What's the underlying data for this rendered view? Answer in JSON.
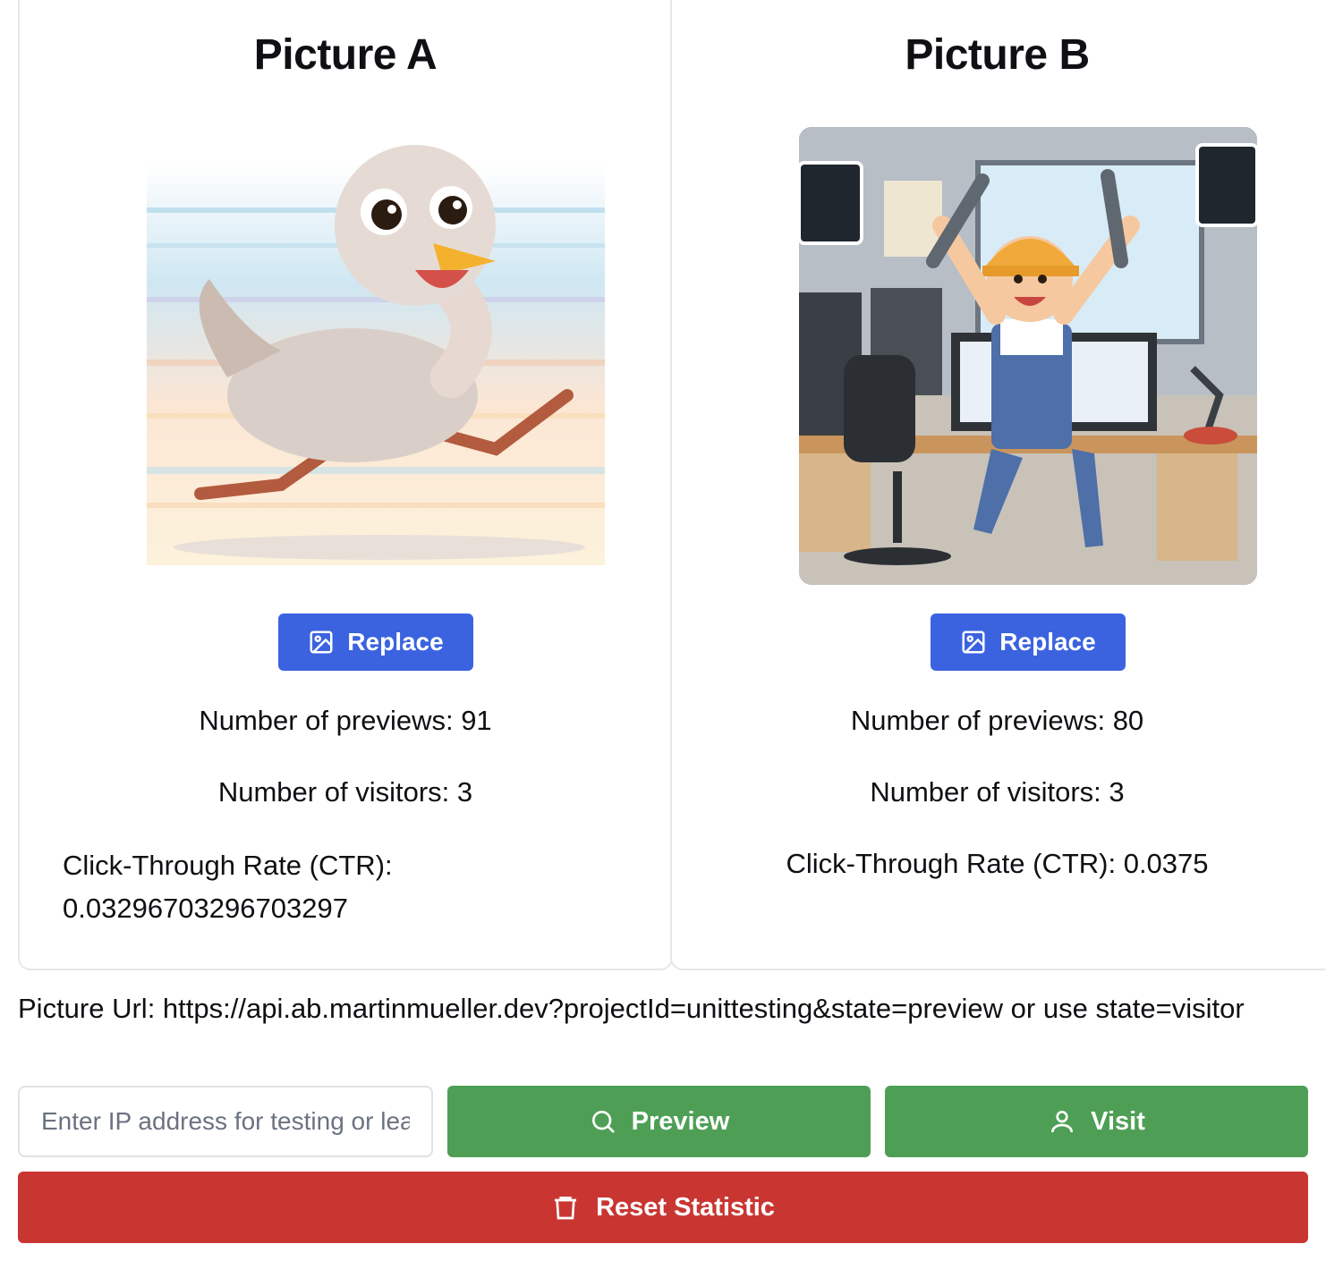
{
  "picture_a": {
    "title": "Picture A",
    "image": "cartoon-running-ostrich-chick",
    "replace_label": "Replace",
    "previews_text": "Number of previews: 91",
    "visitors_text": "Number of visitors: 3",
    "ctr_text": "Click-Through Rate (CTR): 0.03296703296703297"
  },
  "picture_b": {
    "title": "Picture B",
    "image": "cartoon-happy-developer-with-wrenches",
    "replace_label": "Replace",
    "previews_text": "Number of previews: 80",
    "visitors_text": "Number of visitors: 3",
    "ctr_text": "Click-Through Rate (CTR): 0.0375"
  },
  "url_text": "Picture Url: https://api.ab.martinmueller.dev?projectId=unittesting&state=preview or use state=visitor",
  "ip_input": {
    "placeholder": "Enter IP address for testing or leave empty",
    "value": ""
  },
  "buttons": {
    "preview_label": "Preview",
    "visit_label": "Visit",
    "reset_label": "Reset Statistic"
  },
  "colors": {
    "primary_blue": "#3b63e0",
    "success_green": "#4e9f55",
    "danger_red": "#c93632"
  },
  "icons": {
    "replace": "image-icon",
    "preview": "search-icon",
    "visit": "user-icon",
    "reset": "trash-icon"
  }
}
